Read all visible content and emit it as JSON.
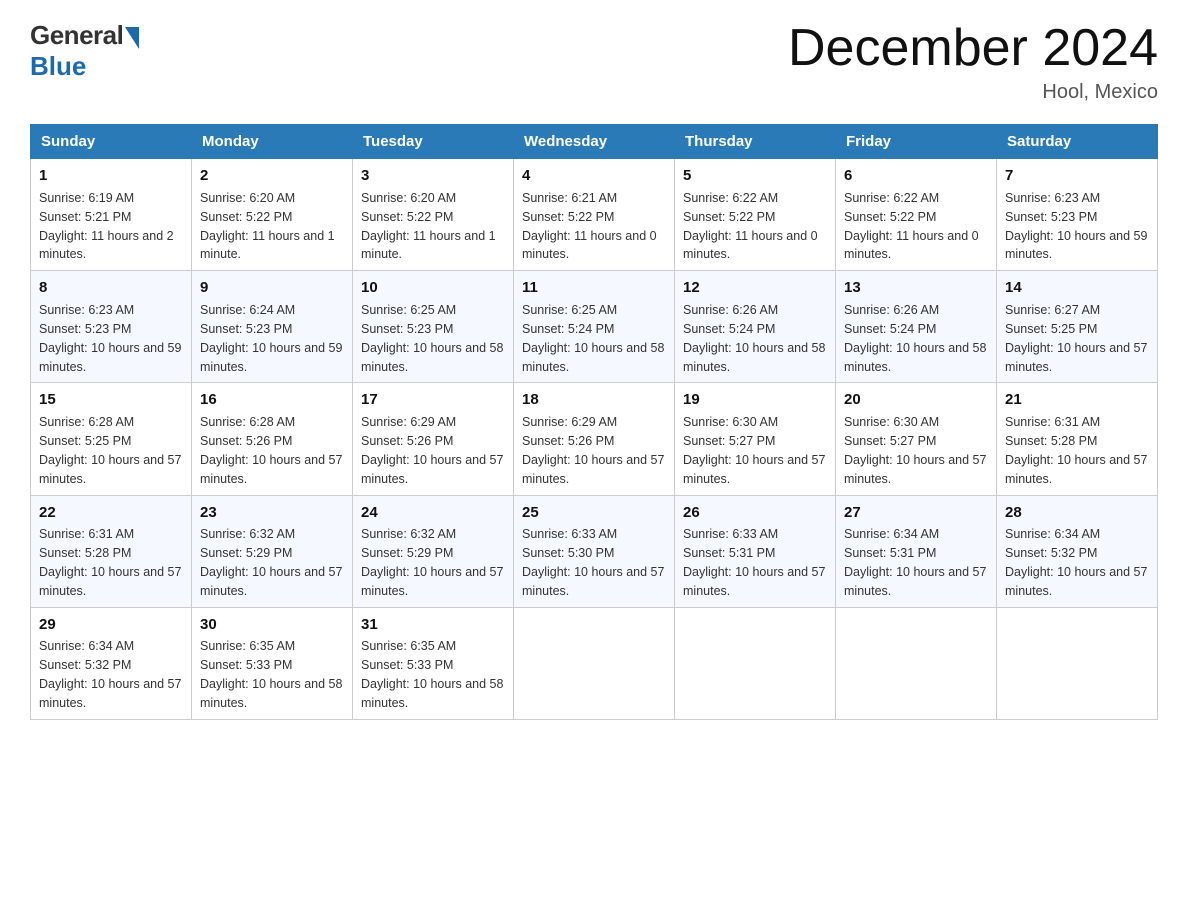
{
  "logo": {
    "general": "General",
    "blue": "Blue"
  },
  "title": "December 2024",
  "location": "Hool, Mexico",
  "days_of_week": [
    "Sunday",
    "Monday",
    "Tuesday",
    "Wednesday",
    "Thursday",
    "Friday",
    "Saturday"
  ],
  "weeks": [
    [
      {
        "day": "1",
        "sunrise": "6:19 AM",
        "sunset": "5:21 PM",
        "daylight": "11 hours and 2 minutes."
      },
      {
        "day": "2",
        "sunrise": "6:20 AM",
        "sunset": "5:22 PM",
        "daylight": "11 hours and 1 minute."
      },
      {
        "day": "3",
        "sunrise": "6:20 AM",
        "sunset": "5:22 PM",
        "daylight": "11 hours and 1 minute."
      },
      {
        "day": "4",
        "sunrise": "6:21 AM",
        "sunset": "5:22 PM",
        "daylight": "11 hours and 0 minutes."
      },
      {
        "day": "5",
        "sunrise": "6:22 AM",
        "sunset": "5:22 PM",
        "daylight": "11 hours and 0 minutes."
      },
      {
        "day": "6",
        "sunrise": "6:22 AM",
        "sunset": "5:22 PM",
        "daylight": "11 hours and 0 minutes."
      },
      {
        "day": "7",
        "sunrise": "6:23 AM",
        "sunset": "5:23 PM",
        "daylight": "10 hours and 59 minutes."
      }
    ],
    [
      {
        "day": "8",
        "sunrise": "6:23 AM",
        "sunset": "5:23 PM",
        "daylight": "10 hours and 59 minutes."
      },
      {
        "day": "9",
        "sunrise": "6:24 AM",
        "sunset": "5:23 PM",
        "daylight": "10 hours and 59 minutes."
      },
      {
        "day": "10",
        "sunrise": "6:25 AM",
        "sunset": "5:23 PM",
        "daylight": "10 hours and 58 minutes."
      },
      {
        "day": "11",
        "sunrise": "6:25 AM",
        "sunset": "5:24 PM",
        "daylight": "10 hours and 58 minutes."
      },
      {
        "day": "12",
        "sunrise": "6:26 AM",
        "sunset": "5:24 PM",
        "daylight": "10 hours and 58 minutes."
      },
      {
        "day": "13",
        "sunrise": "6:26 AM",
        "sunset": "5:24 PM",
        "daylight": "10 hours and 58 minutes."
      },
      {
        "day": "14",
        "sunrise": "6:27 AM",
        "sunset": "5:25 PM",
        "daylight": "10 hours and 57 minutes."
      }
    ],
    [
      {
        "day": "15",
        "sunrise": "6:28 AM",
        "sunset": "5:25 PM",
        "daylight": "10 hours and 57 minutes."
      },
      {
        "day": "16",
        "sunrise": "6:28 AM",
        "sunset": "5:26 PM",
        "daylight": "10 hours and 57 minutes."
      },
      {
        "day": "17",
        "sunrise": "6:29 AM",
        "sunset": "5:26 PM",
        "daylight": "10 hours and 57 minutes."
      },
      {
        "day": "18",
        "sunrise": "6:29 AM",
        "sunset": "5:26 PM",
        "daylight": "10 hours and 57 minutes."
      },
      {
        "day": "19",
        "sunrise": "6:30 AM",
        "sunset": "5:27 PM",
        "daylight": "10 hours and 57 minutes."
      },
      {
        "day": "20",
        "sunrise": "6:30 AM",
        "sunset": "5:27 PM",
        "daylight": "10 hours and 57 minutes."
      },
      {
        "day": "21",
        "sunrise": "6:31 AM",
        "sunset": "5:28 PM",
        "daylight": "10 hours and 57 minutes."
      }
    ],
    [
      {
        "day": "22",
        "sunrise": "6:31 AM",
        "sunset": "5:28 PM",
        "daylight": "10 hours and 57 minutes."
      },
      {
        "day": "23",
        "sunrise": "6:32 AM",
        "sunset": "5:29 PM",
        "daylight": "10 hours and 57 minutes."
      },
      {
        "day": "24",
        "sunrise": "6:32 AM",
        "sunset": "5:29 PM",
        "daylight": "10 hours and 57 minutes."
      },
      {
        "day": "25",
        "sunrise": "6:33 AM",
        "sunset": "5:30 PM",
        "daylight": "10 hours and 57 minutes."
      },
      {
        "day": "26",
        "sunrise": "6:33 AM",
        "sunset": "5:31 PM",
        "daylight": "10 hours and 57 minutes."
      },
      {
        "day": "27",
        "sunrise": "6:34 AM",
        "sunset": "5:31 PM",
        "daylight": "10 hours and 57 minutes."
      },
      {
        "day": "28",
        "sunrise": "6:34 AM",
        "sunset": "5:32 PM",
        "daylight": "10 hours and 57 minutes."
      }
    ],
    [
      {
        "day": "29",
        "sunrise": "6:34 AM",
        "sunset": "5:32 PM",
        "daylight": "10 hours and 57 minutes."
      },
      {
        "day": "30",
        "sunrise": "6:35 AM",
        "sunset": "5:33 PM",
        "daylight": "10 hours and 58 minutes."
      },
      {
        "day": "31",
        "sunrise": "6:35 AM",
        "sunset": "5:33 PM",
        "daylight": "10 hours and 58 minutes."
      },
      null,
      null,
      null,
      null
    ]
  ],
  "labels": {
    "sunrise": "Sunrise:",
    "sunset": "Sunset:",
    "daylight": "Daylight:"
  }
}
